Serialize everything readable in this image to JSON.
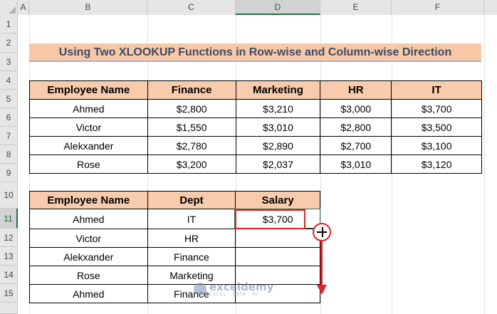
{
  "sheet": {
    "columns": [
      "A",
      "B",
      "C",
      "D",
      "E",
      "F"
    ],
    "rows": [
      "1",
      "2",
      "3",
      "4",
      "5",
      "6",
      "7",
      "8",
      "9",
      "10",
      "11",
      "12",
      "13",
      "14",
      "15"
    ],
    "active_column": "D",
    "active_row": "11"
  },
  "title": "Using Two XLOOKUP Functions in Row-wise and Column-wise Direction",
  "table1": {
    "headers": [
      "Employee Name",
      "Finance",
      "Marketing",
      "HR",
      "IT"
    ],
    "rows": [
      [
        "Ahmed",
        "$2,800",
        "$3,210",
        "$3,000",
        "$3,700"
      ],
      [
        "Victor",
        "$1,550",
        "$3,010",
        "$2,800",
        "$3,500"
      ],
      [
        "Alekxander",
        "$2,780",
        "$2,890",
        "$2,700",
        "$3,100"
      ],
      [
        "Rose",
        "$3,200",
        "$2,037",
        "$3,010",
        "$3,120"
      ]
    ]
  },
  "table2": {
    "headers": [
      "Employee Name",
      "Dept",
      "Salary"
    ],
    "rows": [
      [
        "Ahmed",
        "IT",
        "$3,700"
      ],
      [
        "Victor",
        "HR",
        ""
      ],
      [
        "Alekxander",
        "Finance",
        ""
      ],
      [
        "Rose",
        "Marketing",
        ""
      ],
      [
        "Ahmed",
        "Finance",
        ""
      ]
    ]
  },
  "watermark": {
    "name": "exceldemy",
    "tagline": "EXCEL · DATA · BI"
  },
  "colors": {
    "header_fill": "#f8cbad",
    "title_fill": "#f8c8a4",
    "selection": "#217346",
    "annotation": "#e0232c"
  }
}
